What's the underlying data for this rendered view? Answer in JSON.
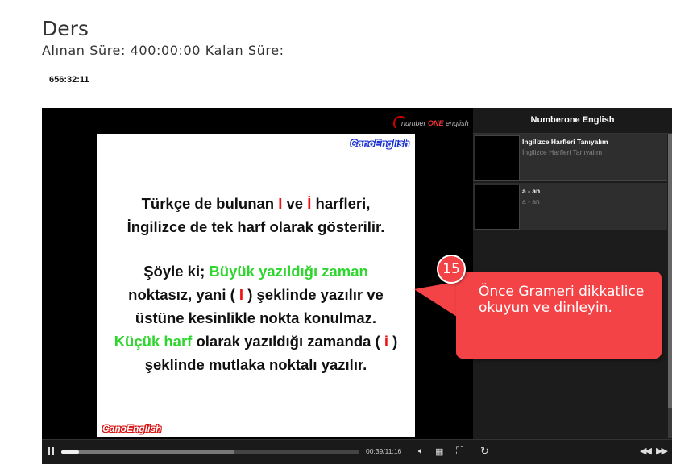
{
  "page": {
    "title": "Ders",
    "time_line": "Alınan Süre: 400:00:00 Kalan Süre:",
    "countdown": "656:32:11"
  },
  "player": {
    "brand_prefix": "number ",
    "brand_one": "ONE",
    "brand_suffix": " english",
    "slide": {
      "brand": "CanoEnglish",
      "l1a": "Türkçe de bulunan ",
      "l1b": "I",
      "l1c": " ve ",
      "l1d": "İ",
      "l1e": " harfleri,",
      "l2": "İngilizce de tek harf olarak gösterilir.",
      "l3a": "Şöyle ki; ",
      "l3b": "Büyük yazıldığı zaman",
      "l4a": "noktasız, yani ( ",
      "l4b": "I",
      "l4c": " ) şeklinde yazılır ve",
      "l5": "üstüne kesinlikle nokta konulmaz.",
      "l6a": "Küçük harf",
      "l6b": " olarak yazıldığı zamanda ( ",
      "l6c": "i",
      "l6d": " )",
      "l7": "şeklinde mutlaka noktalı yazılır."
    },
    "playlist": {
      "header": "Numberone English",
      "items": [
        {
          "title": "İngilizce Harfleri Tanıyalım",
          "desc": "İngilizce Harfleri Tanıyalım"
        },
        {
          "title": "a - an",
          "desc": "a - an"
        }
      ]
    },
    "controls": {
      "time": "00:39/11:16",
      "progress_played": 0.06,
      "progress_buffered": 0.58,
      "icons": [
        "pause-icon",
        "volume-icon",
        "hd-icon",
        "fullscreen-icon",
        "refresh-icon",
        "previous-icon",
        "next-icon"
      ]
    }
  },
  "tutorial": {
    "step": "15",
    "text": "Önce Grameri dikkatlice okuyun ve dinleyin.",
    "color": "#f44346"
  }
}
